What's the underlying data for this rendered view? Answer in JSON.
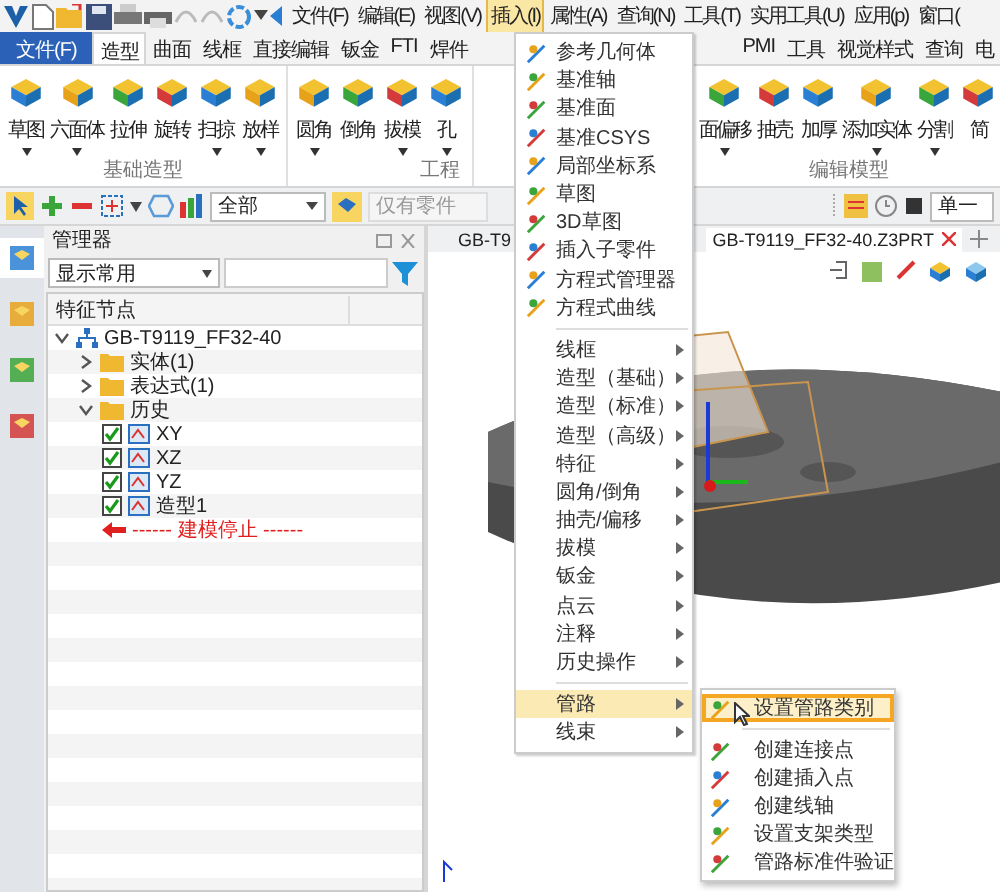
{
  "menu_bar": [
    {
      "label": "文件(F)",
      "selected": false
    },
    {
      "label": "编辑(E)",
      "selected": false
    },
    {
      "label": "视图(V)",
      "selected": false
    },
    {
      "label": "插入(I)",
      "selected": true
    },
    {
      "label": "属性(A)",
      "selected": false
    },
    {
      "label": "查询(N)",
      "selected": false
    },
    {
      "label": "工具(T)",
      "selected": false
    },
    {
      "label": "实用工具(U)",
      "selected": false
    },
    {
      "label": "应用(p)",
      "selected": false
    },
    {
      "label": "窗口(",
      "selected": false
    }
  ],
  "ribbon_tabs": {
    "left": [
      {
        "label": "文件(F)",
        "kind": "file",
        "selected": false
      },
      {
        "label": "造型",
        "kind": "tab",
        "selected": true
      },
      {
        "label": "曲面",
        "kind": "tab",
        "selected": false
      },
      {
        "label": "线框",
        "kind": "tab",
        "selected": false
      },
      {
        "label": "直接编辑",
        "kind": "tab",
        "selected": false
      },
      {
        "label": "钣金",
        "kind": "tab",
        "selected": false
      },
      {
        "label": "FTI",
        "kind": "tab",
        "selected": false
      },
      {
        "label": "焊件",
        "kind": "tab",
        "selected": false
      }
    ],
    "right": [
      {
        "label": "PMI",
        "kind": "tab",
        "selected": false
      },
      {
        "label": "工具",
        "kind": "tab",
        "selected": false
      },
      {
        "label": "视觉样式",
        "kind": "tab",
        "selected": false
      },
      {
        "label": "查询",
        "kind": "tab",
        "selected": false
      },
      {
        "label": "电",
        "kind": "tab",
        "selected": false
      }
    ]
  },
  "ribbon_groups": [
    {
      "label": "基础造型",
      "tools": [
        {
          "label": "草图",
          "dropdown": true
        },
        {
          "label": "六面体",
          "dropdown": true
        },
        {
          "label": "拉伸",
          "dropdown": false
        },
        {
          "label": "旋转",
          "dropdown": false
        },
        {
          "label": "扫掠",
          "dropdown": true
        },
        {
          "label": "放样",
          "dropdown": true
        }
      ]
    },
    {
      "label": "工程",
      "tools": [
        {
          "label": "圆角",
          "dropdown": true
        },
        {
          "label": "倒角",
          "dropdown": false
        },
        {
          "label": "拔模",
          "dropdown": true
        },
        {
          "label": "孔",
          "dropdown": true
        }
      ]
    },
    {
      "label": "编辑模型",
      "tools": [
        {
          "label": "面偏移",
          "dropdown": true
        },
        {
          "label": "抽壳",
          "dropdown": false
        },
        {
          "label": "加厚",
          "dropdown": false
        },
        {
          "label": "添加实体",
          "dropdown": true
        },
        {
          "label": "分割",
          "dropdown": true
        },
        {
          "label": "简",
          "dropdown": false
        }
      ]
    }
  ],
  "toolbar": {
    "filter_value": "全部",
    "scope_placeholder": "仅有零件",
    "mode_value": "单一"
  },
  "manager": {
    "title": "管理器",
    "side_tabs": [
      {
        "selected": true
      },
      {
        "selected": false
      },
      {
        "selected": false
      },
      {
        "selected": false
      }
    ],
    "display_filter": "显示常用",
    "tree": {
      "header": "特征节点",
      "nodes": [
        {
          "label": "GB-T9119_FF32-40",
          "kind": "part",
          "expanded": true,
          "children": [
            {
              "label": "实体(1)",
              "kind": "folder",
              "expanded": false
            },
            {
              "label": "表达式(1)",
              "kind": "folder",
              "expanded": false
            },
            {
              "label": "历史",
              "kind": "folder",
              "expanded": true,
              "children": [
                {
                  "label": "XY",
                  "kind": "feature",
                  "checked": true
                },
                {
                  "label": "XZ",
                  "kind": "feature",
                  "checked": true
                },
                {
                  "label": "YZ",
                  "kind": "feature",
                  "checked": true
                },
                {
                  "label": "造型1",
                  "kind": "feature",
                  "checked": true
                },
                {
                  "label": "------ 建模停止 ------",
                  "kind": "stop"
                }
              ]
            }
          ]
        }
      ]
    }
  },
  "viewport": {
    "tabs": [
      {
        "label": "GB-T9",
        "selected": false
      },
      {
        "label": "GB-T9119_FF32-40.Z3PRT",
        "selected": true
      }
    ]
  },
  "insert_menu": {
    "sections": [
      [
        {
          "label": "参考几何体",
          "kind": "command",
          "selected": false
        },
        {
          "label": "基准轴",
          "kind": "command",
          "selected": false
        },
        {
          "label": "基准面",
          "kind": "command",
          "selected": false
        },
        {
          "label": "基准CSYS",
          "kind": "command",
          "selected": false
        },
        {
          "label": "局部坐标系",
          "kind": "command",
          "selected": false
        },
        {
          "label": "草图",
          "kind": "command",
          "selected": false
        },
        {
          "label": "3D草图",
          "kind": "command",
          "selected": false
        },
        {
          "label": "插入子零件",
          "kind": "command",
          "selected": false
        },
        {
          "label": "方程式管理器",
          "kind": "command",
          "selected": false
        },
        {
          "label": "方程式曲线",
          "kind": "command",
          "selected": false
        }
      ],
      [
        {
          "label": "线框",
          "kind": "submenu",
          "selected": false
        },
        {
          "label": "造型（基础）",
          "kind": "submenu",
          "selected": false
        },
        {
          "label": "造型（标准）",
          "kind": "submenu",
          "selected": false
        },
        {
          "label": "造型（高级）",
          "kind": "submenu",
          "selected": false
        },
        {
          "label": "特征",
          "kind": "submenu",
          "selected": false
        },
        {
          "label": "圆角/倒角",
          "kind": "submenu",
          "selected": false
        },
        {
          "label": "抽壳/偏移",
          "kind": "submenu",
          "selected": false
        },
        {
          "label": "拔模",
          "kind": "submenu",
          "selected": false
        },
        {
          "label": "钣金",
          "kind": "submenu",
          "selected": false
        },
        {
          "label": "点云",
          "kind": "submenu",
          "selected": false
        },
        {
          "label": "注释",
          "kind": "submenu",
          "selected": false
        },
        {
          "label": "历史操作",
          "kind": "submenu",
          "selected": false
        }
      ],
      [
        {
          "label": "管路",
          "kind": "submenu",
          "selected": true
        },
        {
          "label": "线束",
          "kind": "submenu",
          "selected": false
        }
      ]
    ]
  },
  "piping_submenu": {
    "items": [
      {
        "label": "设置管路类别",
        "selected": true
      },
      {
        "label": "创建连接点",
        "selected": false
      },
      {
        "label": "创建插入点",
        "selected": false
      },
      {
        "label": "创建线轴",
        "selected": false
      },
      {
        "label": "设置支架类型",
        "selected": false
      },
      {
        "label": "管路标准件验证",
        "selected": false
      }
    ]
  }
}
